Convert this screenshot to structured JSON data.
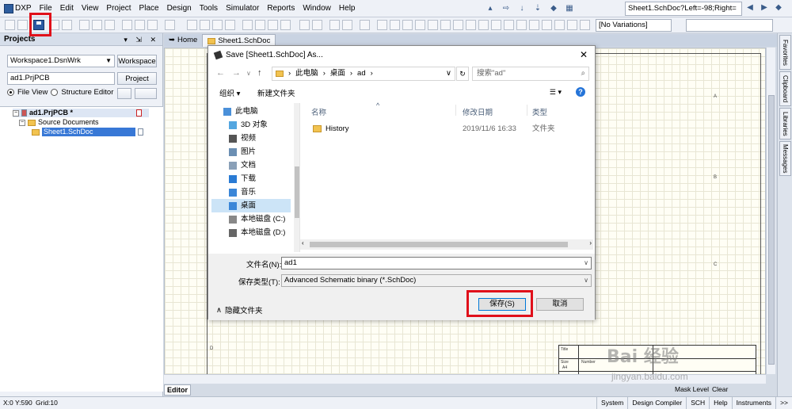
{
  "menubar": {
    "items": [
      "DXP",
      "File",
      "Edit",
      "View",
      "Project",
      "Place",
      "Design",
      "Tools",
      "Simulator",
      "Reports",
      "Window",
      "Help"
    ]
  },
  "address_bar": {
    "value": "Sheet1.SchDoc?Left=-98;Right="
  },
  "toolbar": {
    "variations": "[No Variations]"
  },
  "projects_panel": {
    "title": "Projects",
    "controls": "▾ ⇲ ✕",
    "workspace_select": "Workspace1.DsnWrk",
    "workspace_button": "Workspace",
    "project_field": "ad1.PrjPCB",
    "project_button": "Project",
    "file_view": "File View",
    "structure_editor": "Structure Editor",
    "tree": {
      "project": "ad1.PrjPCB *",
      "folder": "Source Documents",
      "document": "Sheet1.SchDoc"
    }
  },
  "doc_tabs": [
    "Home",
    "Sheet1.SchDoc"
  ],
  "editor_tab": "Editor",
  "editor_right_links": [
    "Mask Level",
    "Clear"
  ],
  "side_tabs": [
    "Favorites",
    "Clipboard",
    "Libraries",
    "Messages"
  ],
  "statusbar": {
    "coords": "X:0 Y:590",
    "grid": "Grid:10",
    "tabs": [
      "System",
      "Design Compiler",
      "SCH",
      "Help",
      "Instruments",
      ">>"
    ]
  },
  "title_block": {
    "title": "Title",
    "size": "Size",
    "number": "Number",
    "size_value": "A4"
  },
  "dialog": {
    "title": "Save [Sheet1.SchDoc] As...",
    "path": [
      "此电脑",
      "桌面",
      "ad"
    ],
    "search_placeholder": "搜索\"ad\"",
    "organize": "组织 ▾",
    "new_folder": "新建文件夹",
    "nav_items": [
      "此电脑",
      "3D 对象",
      "视频",
      "图片",
      "文档",
      "下载",
      "音乐",
      "桌面",
      "本地磁盘 (C:)",
      "本地磁盘 (D:)"
    ],
    "columns": [
      "名称",
      "修改日期",
      "类型"
    ],
    "files": [
      {
        "name": "History",
        "date": "2019/11/6 16:33",
        "type": "文件夹"
      }
    ],
    "filename_label": "文件名(N):",
    "filename_value": "ad1",
    "filetype_label": "保存类型(T):",
    "filetype_value": "Advanced Schematic binary (*.SchDoc)",
    "hide_folders": "隐藏文件夹",
    "save_button": "保存(S)",
    "cancel_button": "取消"
  },
  "watermark": {
    "logo": "Bai 经验",
    "sub": "jingyan.baidu.com"
  }
}
